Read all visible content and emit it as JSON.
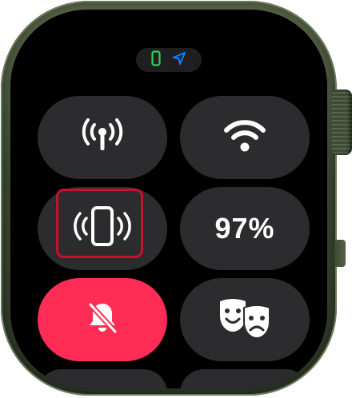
{
  "status_bar": {
    "icons": [
      "phone-connected-icon",
      "location-arrow-icon"
    ],
    "colors": {
      "phone": "#30d158",
      "location": "#0a84ff"
    }
  },
  "controls": [
    {
      "id": "cellular",
      "icon": "cellular-antenna-icon",
      "state": "off"
    },
    {
      "id": "wifi",
      "icon": "wifi-icon",
      "state": "off"
    },
    {
      "id": "ping-iphone",
      "icon": "ping-iphone-icon",
      "state": "off",
      "highlighted": true
    },
    {
      "id": "battery",
      "icon": "battery-percent",
      "label": "97%",
      "level": 0.97
    },
    {
      "id": "silent-mode",
      "icon": "bell-slash-icon",
      "state": "on"
    },
    {
      "id": "theater-mode",
      "icon": "theater-masks-icon",
      "state": "off"
    }
  ],
  "battery": {
    "label": "97%"
  },
  "colors": {
    "tile_background": "#2c2c2e",
    "silent_active": "#ff2d55",
    "highlight": "#c8102e",
    "icon": "#ffffff",
    "case": "#3d4933"
  }
}
